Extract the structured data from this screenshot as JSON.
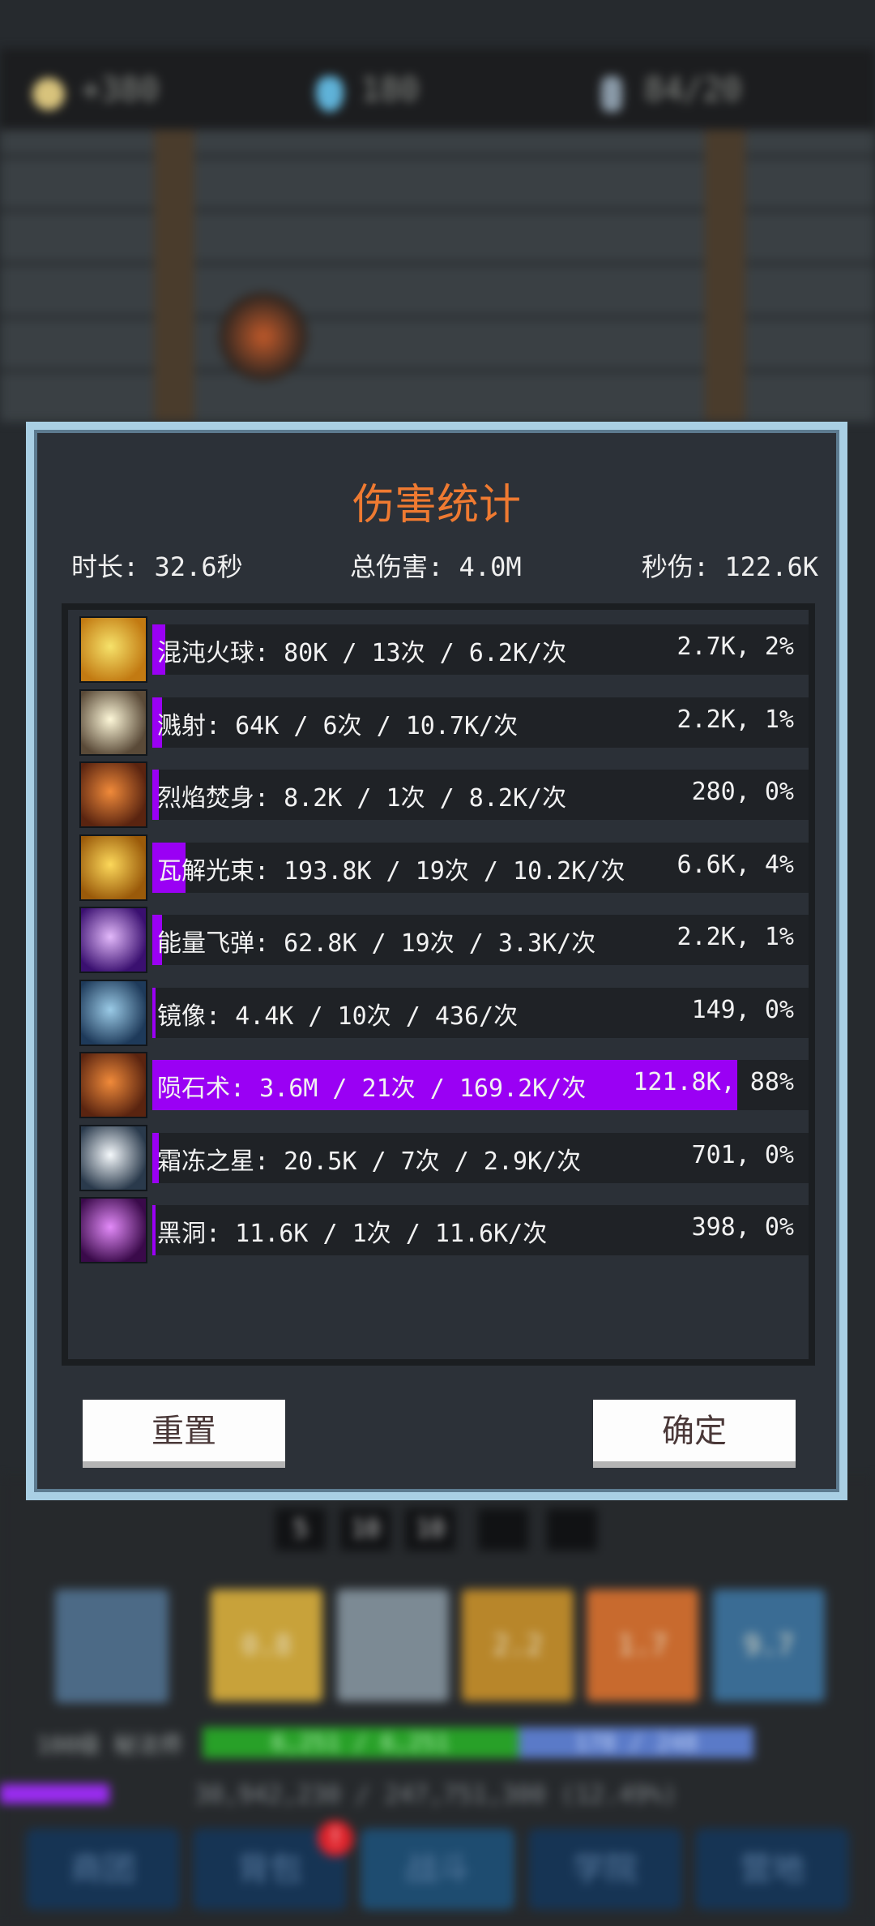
{
  "background": {
    "hud": {
      "gold": "+380",
      "gems": "180",
      "keys": "84/20"
    },
    "quick_slots": [
      "5",
      "10",
      "10",
      "",
      ""
    ],
    "skill_slots": [
      {
        "label": "0.8",
        "color": "#c8a23a"
      },
      {
        "label": "",
        "color": "#7c8a94"
      },
      {
        "label": "2.2",
        "color": "#b8862a"
      },
      {
        "label": "1.7",
        "color": "#c86a2e"
      },
      {
        "label": "9.7",
        "color": "#3a6c94"
      }
    ],
    "level_label": "100级 秘法师",
    "hp": "6,251 / 6,251",
    "mp": "178 / 248",
    "xp_text": "30,942,230 / 247,751,300 (12.49%)",
    "xp_fraction": 0.125,
    "nav": [
      "商团",
      "背包",
      "战斗",
      "学院",
      "营地"
    ],
    "nav_badge": "!"
  },
  "dialog": {
    "title": "伤害统计",
    "duration": "时长: 32.6秒",
    "total": "总伤害: 4.0M",
    "dps": "秒伤: 122.6K",
    "reset_label": "重置",
    "ok_label": "确定",
    "skills": [
      {
        "icon": "chaos-fireball-icon",
        "colors": [
          "#f6e26a",
          "#c27a12"
        ],
        "name": "混沌火球: 80K / 13次 / 6.2K/次",
        "dps": "2.7K, 2%",
        "share": 0.02
      },
      {
        "icon": "burst-icon",
        "colors": [
          "#fdf7d8",
          "#5a4a38"
        ],
        "name": "溅射: 64K / 6次 / 10.7K/次",
        "dps": "2.2K, 1%",
        "share": 0.015
      },
      {
        "icon": "flame-body-icon",
        "colors": [
          "#f08a3a",
          "#5a2410"
        ],
        "name": "烈焰焚身: 8.2K / 1次 / 8.2K/次",
        "dps": "280, 0%",
        "share": 0.005
      },
      {
        "icon": "disintegrate-beam-icon",
        "colors": [
          "#fcd85a",
          "#9a5a0a"
        ],
        "name": "瓦解光束: 193.8K / 19次 / 10.2K/次",
        "dps": "6.6K, 4%",
        "share": 0.05
      },
      {
        "icon": "energy-missile-icon",
        "colors": [
          "#e2b8fa",
          "#3a1070"
        ],
        "name": "能量飞弹: 62.8K / 19次 / 3.3K/次",
        "dps": "2.2K, 1%",
        "share": 0.015
      },
      {
        "icon": "mirror-image-icon",
        "colors": [
          "#9acae6",
          "#1e3a5a"
        ],
        "name": "镜像: 4.4K / 10次 / 436/次",
        "dps": "149, 0%",
        "share": 0.0
      },
      {
        "icon": "meteor-icon",
        "colors": [
          "#f08a3a",
          "#5a2410"
        ],
        "name": "陨石术: 3.6M / 21次 / 169.2K/次",
        "dps": "121.8K, 88%",
        "share": 0.88
      },
      {
        "icon": "frost-star-icon",
        "colors": [
          "#f4f8fb",
          "#2a3a4c"
        ],
        "name": "霜冻之星: 20.5K / 7次 / 2.9K/次",
        "dps": "701, 0%",
        "share": 0.005
      },
      {
        "icon": "black-hole-icon",
        "colors": [
          "#e28af8",
          "#3a0a4a"
        ],
        "name": "黑洞: 11.6K / 1次 / 11.6K/次",
        "dps": "398, 0%",
        "share": 0.0
      }
    ]
  }
}
